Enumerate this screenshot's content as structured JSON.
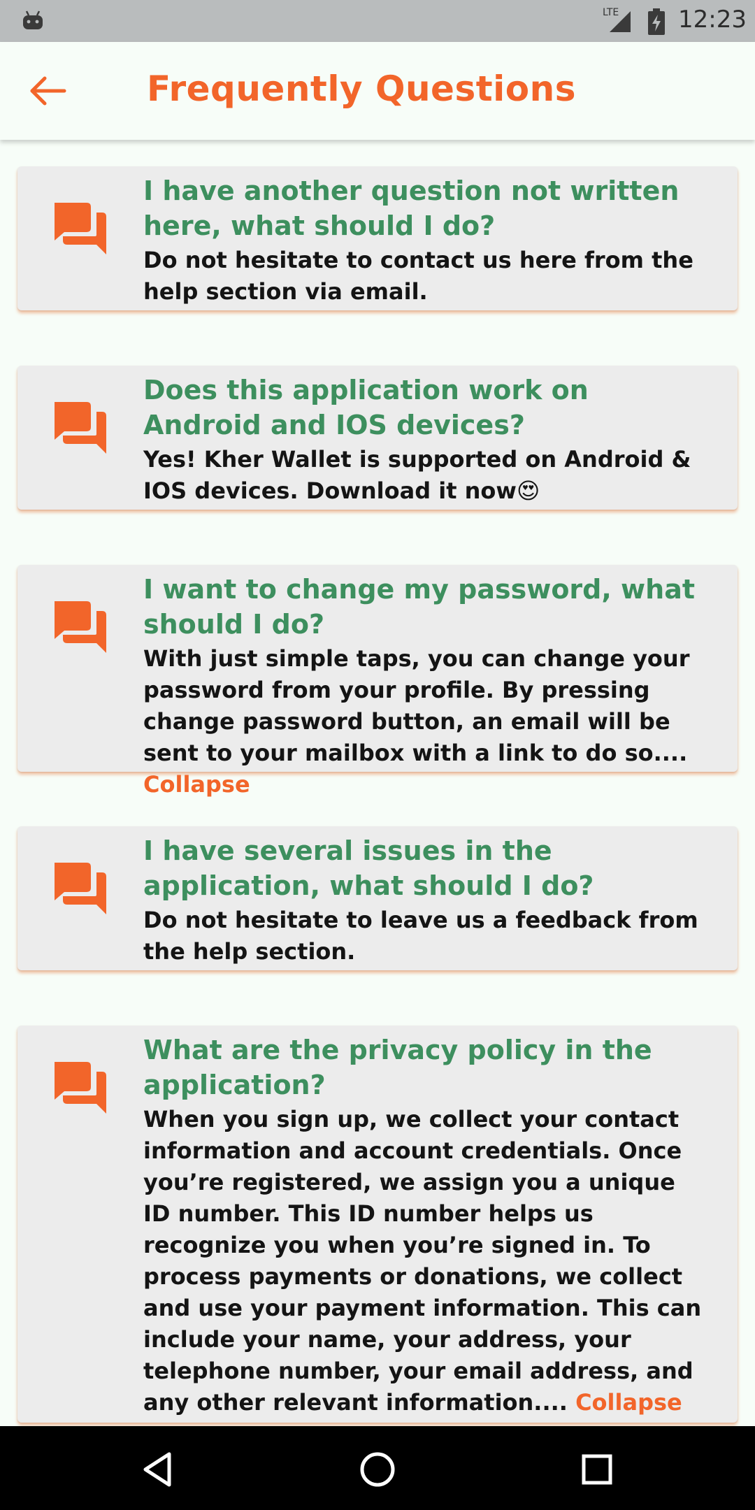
{
  "status_bar": {
    "network": "LTE",
    "time": "12:23",
    "icons": [
      "android-debug-icon",
      "signal-icon",
      "battery-icon"
    ]
  },
  "app_bar": {
    "title": "Frequently Questions",
    "back_icon": "arrow-left-icon"
  },
  "colors": {
    "accent": "#f2652a",
    "question": "#3d8f5e",
    "card": "#ececec",
    "background": "#f7fdf8"
  },
  "faqs": [
    {
      "icon": "chat-bubbles-icon",
      "question": "I have another question not written here, what should I do?",
      "answer": "Do not hesitate to contact us here from the help section via email."
    },
    {
      "icon": "chat-bubbles-icon",
      "question": "Does this application work on Android and IOS devices?",
      "answer": "Yes! Kher Wallet is supported on Android & IOS devices. Download it now",
      "emoji": "😍"
    },
    {
      "icon": "chat-bubbles-icon",
      "question": "I want to change my password, what should I do?",
      "answer": "With just simple taps, you can change your password from your profile. By pressing change password button, an email will be sent to your mailbox with a link to do so....",
      "toggle": "Collapse"
    },
    {
      "icon": "chat-bubbles-icon",
      "question": "I have several issues in the application, what should I do?",
      "answer": "Do not hesitate to leave us a feedback from the help section."
    },
    {
      "icon": "chat-bubbles-icon",
      "question": "What are the privacy policy in the application?",
      "answer": "When you sign up, we collect your contact information and account credentials. Once you’re registered, we assign you a unique ID number. This ID number helps us recognize you when you’re signed in.  To process payments or donations, we collect and use your payment information. This can include your name, your address, your telephone number, your email address, and any other relevant information....",
      "toggle": "Collapse"
    }
  ],
  "nav_bar": {
    "buttons": [
      "back-triangle-icon",
      "home-circle-icon",
      "recents-square-icon"
    ]
  }
}
